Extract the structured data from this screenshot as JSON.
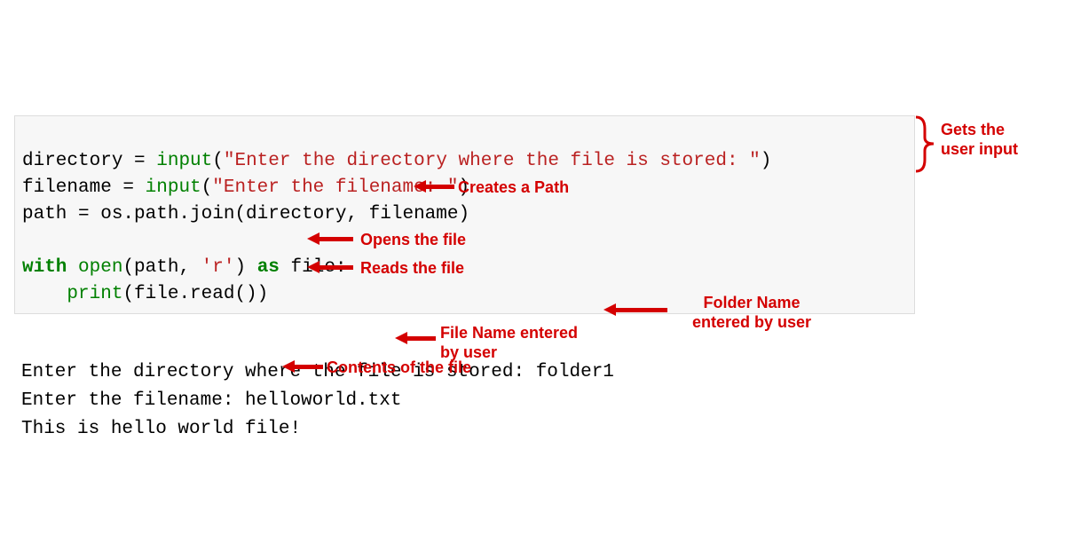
{
  "code": {
    "l1_var": "directory ",
    "l1_eq": "= ",
    "l1_fn": "input",
    "l1_paren_open": "(",
    "l1_str": "\"Enter the directory where the file is stored: \"",
    "l1_paren_close": ")",
    "l2_var": "filename ",
    "l2_eq": "= ",
    "l2_fn": "input",
    "l2_paren_open": "(",
    "l2_str": "\"Enter the filename: \"",
    "l2_paren_close": ")",
    "l3": "path = os.path.join(directory, filename)",
    "l4": "",
    "l5_kw1": "with",
    "l5_sp1": " ",
    "l5_fn": "open",
    "l5_args_open": "(path, ",
    "l5_str": "'r'",
    "l5_args_close": ") ",
    "l5_kw2": "as",
    "l5_rest": " file:",
    "l6_indent": "    ",
    "l6_fn": "print",
    "l6_rest": "(file.read())"
  },
  "output": {
    "l1": "Enter the directory where the file is stored: folder1",
    "l2": "Enter the filename: helloworld.txt",
    "l3": "This is hello world file!"
  },
  "annotations": {
    "gets_input": "Gets the\nuser input",
    "creates_path": "Creates a Path",
    "opens_file": "Opens the file",
    "reads_file": "Reads the file",
    "folder_name": "Folder Name\nentered by user",
    "file_name": "File Name entered\nby user",
    "contents": "Contents of the file"
  }
}
